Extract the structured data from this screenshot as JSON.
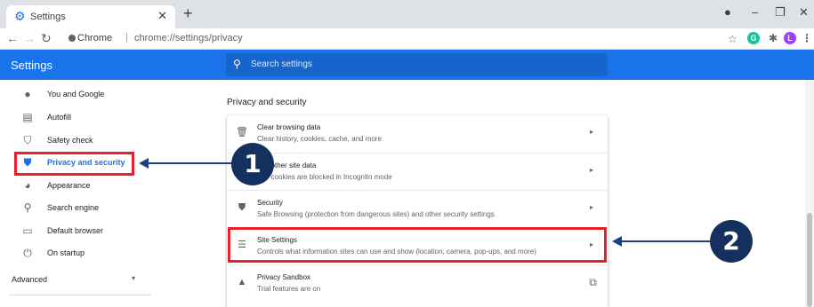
{
  "browser": {
    "tab_title": "Settings",
    "site_label": "Chrome",
    "url": "chrome://settings/privacy",
    "profile_initial": "L",
    "grammarly_initial": "G"
  },
  "header": {
    "title": "Settings",
    "search_placeholder": "Search settings"
  },
  "sidebar": {
    "items": [
      {
        "label": "You and Google",
        "icon": "person-icon"
      },
      {
        "label": "Autofill",
        "icon": "clipboard-icon"
      },
      {
        "label": "Safety check",
        "icon": "shield-check-icon"
      },
      {
        "label": "Privacy and security",
        "icon": "shield-icon",
        "active": true
      },
      {
        "label": "Appearance",
        "icon": "palette-icon"
      },
      {
        "label": "Search engine",
        "icon": "search-icon"
      },
      {
        "label": "Default browser",
        "icon": "browser-icon"
      },
      {
        "label": "On startup",
        "icon": "power-icon"
      }
    ],
    "advanced_label": "Advanced"
  },
  "main": {
    "section_title": "Privacy and security",
    "rows": [
      {
        "title": "Clear browsing data",
        "subtitle": "Clear history, cookies, cache, and more",
        "icon": "trash-icon"
      },
      {
        "title": "and other site data",
        "subtitle": "arty cookies are blocked in Incognito mode",
        "icon": "cookie-icon"
      },
      {
        "title": "Security",
        "subtitle": "Safe Browsing (protection from dangerous sites) and other security settings",
        "icon": "security-shield-icon"
      },
      {
        "title": "Site Settings",
        "subtitle": "Controls what information sites can use and show (location, camera, pop-ups, and more)",
        "icon": "sliders-icon"
      },
      {
        "title": "Privacy Sandbox",
        "subtitle": "Trial features are on",
        "icon": "flask-icon"
      }
    ]
  },
  "annotations": {
    "badge1": "1",
    "badge2": "2"
  },
  "colors": {
    "accent": "#1a73e8",
    "highlight": "#e8202a",
    "badge": "#14305e"
  }
}
